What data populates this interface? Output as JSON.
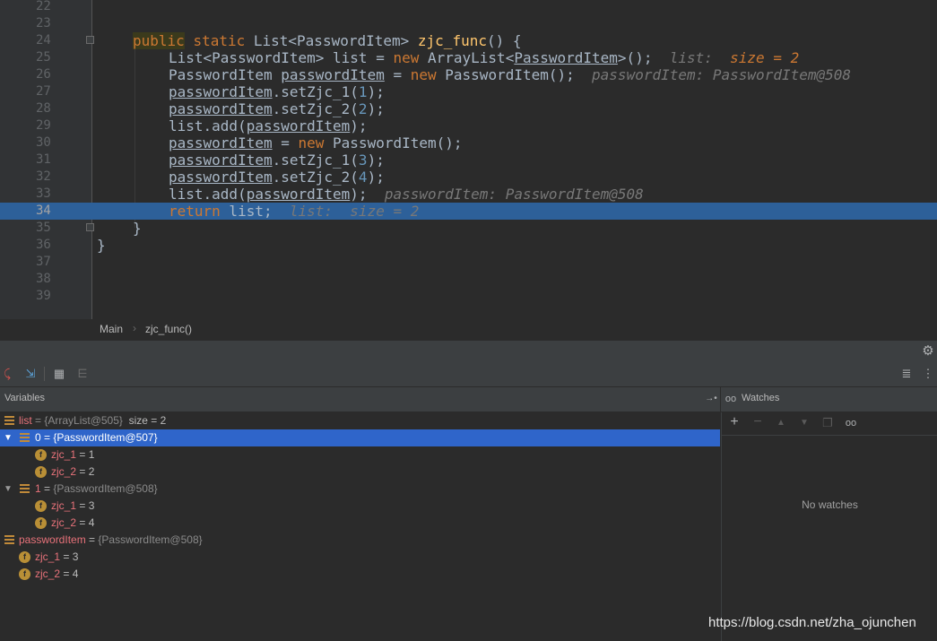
{
  "editor": {
    "lines": [
      {
        "num": "22"
      },
      {
        "num": "23"
      },
      {
        "num": "24"
      },
      {
        "num": "25"
      },
      {
        "num": "26"
      },
      {
        "num": "27"
      },
      {
        "num": "28"
      },
      {
        "num": "29"
      },
      {
        "num": "30"
      },
      {
        "num": "31"
      },
      {
        "num": "32"
      },
      {
        "num": "33"
      },
      {
        "num": "34"
      },
      {
        "num": "35"
      },
      {
        "num": "36"
      },
      {
        "num": "37"
      },
      {
        "num": "38"
      },
      {
        "num": "39"
      }
    ],
    "current_line": "34",
    "code": {
      "l24": {
        "kw1": "public",
        "kw2": "static",
        "type": "List<PasswordItem>",
        "fn": "zjc_func",
        "rest": "() {"
      },
      "l25": {
        "a": "List<PasswordItem> list = ",
        "kw": "new",
        "b": " ArrayList<",
        "c": "PasswordItem",
        "d": ">();",
        "hint": "list:",
        "hintval": "size = 2"
      },
      "l26": {
        "a": "PasswordItem ",
        "b": "passwordItem",
        "c": " = ",
        "kw": "new",
        "d": " PasswordItem();",
        "hint": "passwordItem: PasswordItem@508"
      },
      "l27": {
        "a": "passwordItem",
        "b": ".setZjc_1(",
        "n": "1",
        "c": ");"
      },
      "l28": {
        "a": "passwordItem",
        "b": ".setZjc_2(",
        "n": "2",
        "c": ");"
      },
      "l29": {
        "a": "list.add(",
        "b": "passwordItem",
        "c": ");"
      },
      "l30": {
        "a": "passwordItem",
        "b": " = ",
        "kw": "new",
        "c": " PasswordItem();"
      },
      "l31": {
        "a": "passwordItem",
        "b": ".setZjc_1(",
        "n": "3",
        "c": ");"
      },
      "l32": {
        "a": "passwordItem",
        "b": ".setZjc_2(",
        "n": "4",
        "c": ");"
      },
      "l33": {
        "a": "list.add(",
        "b": "passwordItem",
        "c": ");",
        "hint": "passwordItem: PasswordItem@508"
      },
      "l34": {
        "kw": "return",
        "a": " list;",
        "hint": "list:",
        "hintval": "size = 2"
      },
      "l35": {
        "a": "}"
      },
      "l36": {
        "a": "}"
      }
    }
  },
  "breadcrumb": {
    "class": "Main",
    "method": "zjc_func()"
  },
  "variables_panel": {
    "title": "Variables"
  },
  "watches_panel": {
    "title": "Watches",
    "empty_text": "No watches"
  },
  "variables": {
    "list": {
      "name": "list",
      "value": " = {ArrayList@505}",
      "extra": "  size = 2"
    },
    "item0": {
      "name": "0 = {PasswordItem@507}"
    },
    "item0_f1": {
      "name": "zjc_1",
      "value": " = 1"
    },
    "item0_f2": {
      "name": "zjc_2",
      "value": " = 2"
    },
    "item1": {
      "name": "1",
      "value": " = ",
      "ref": "{PasswordItem@508}"
    },
    "item1_f1": {
      "name": "zjc_1",
      "value": " = 3"
    },
    "item1_f2": {
      "name": "zjc_2",
      "value": " = 4"
    },
    "pw": {
      "name": "passwordItem",
      "value": " = ",
      "ref": "{PasswordItem@508}"
    },
    "pw_f1": {
      "name": "zjc_1",
      "value": " = 3"
    },
    "pw_f2": {
      "name": "zjc_2",
      "value": " = 4"
    }
  },
  "icons": {
    "field_letter": "f"
  },
  "watermark": "https://blog.csdn.net/zha_ojunchen"
}
